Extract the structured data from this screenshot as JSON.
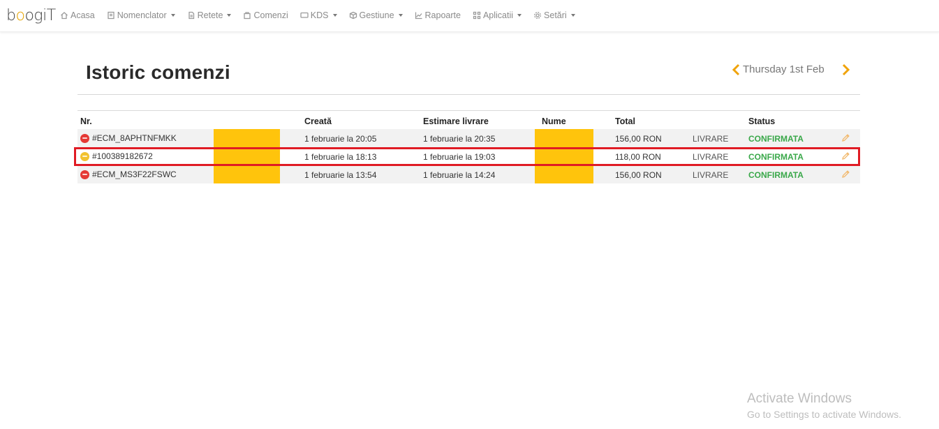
{
  "app": {
    "logo_text_a": "b",
    "logo_text_b": "o",
    "logo_text_c": "ogiT"
  },
  "nav": {
    "items": [
      {
        "label": "Acasa",
        "icon": "home-icon",
        "dropdown": false
      },
      {
        "label": "Nomenclator",
        "icon": "list-icon",
        "dropdown": true
      },
      {
        "label": "Retete",
        "icon": "document-icon",
        "dropdown": true
      },
      {
        "label": "Comenzi",
        "icon": "bag-icon",
        "dropdown": false
      },
      {
        "label": "KDS",
        "icon": "monitor-icon",
        "dropdown": true
      },
      {
        "label": "Gestiune",
        "icon": "box-icon",
        "dropdown": true
      },
      {
        "label": "Rapoarte",
        "icon": "chart-icon",
        "dropdown": false
      },
      {
        "label": "Aplicatii",
        "icon": "grid-icon",
        "dropdown": true
      },
      {
        "label": "Setări",
        "icon": "gear-icon",
        "dropdown": true
      }
    ]
  },
  "page": {
    "title": "Istoric comenzi",
    "date_label": "Thursday 1st Feb"
  },
  "table": {
    "headers": {
      "nr": "Nr.",
      "creata": "Creată",
      "estimare": "Estimare livrare",
      "nume": "Nume",
      "total": "Total",
      "status": "Status"
    },
    "rows": [
      {
        "nr": "#ECM_8APHTNFMKK",
        "source": "red",
        "creata": "1 februarie la 20:05",
        "estimare": "1 februarie la 20:35",
        "total": "156,00 RON",
        "tip": "LIVRARE",
        "status": "CONFIRMATA"
      },
      {
        "nr": "#100389182672",
        "source": "yellow",
        "creata": "1 februarie la 18:13",
        "estimare": "1 februarie la 19:03",
        "total": "118,00 RON",
        "tip": "LIVRARE",
        "status": "CONFIRMATA"
      },
      {
        "nr": "#ECM_MS3F22FSWC",
        "source": "red",
        "creata": "1 februarie la 13:54",
        "estimare": "1 februarie la 14:24",
        "total": "156,00 RON",
        "tip": "LIVRARE",
        "status": "CONFIRMATA"
      }
    ]
  },
  "watermark": {
    "title": "Activate Windows",
    "subtitle": "Go to Settings to activate Windows."
  },
  "colors": {
    "accent": "#f0a30a",
    "status_ok": "#3aa84a",
    "redaction": "#ffc40c",
    "highlight": "#e01b24"
  }
}
